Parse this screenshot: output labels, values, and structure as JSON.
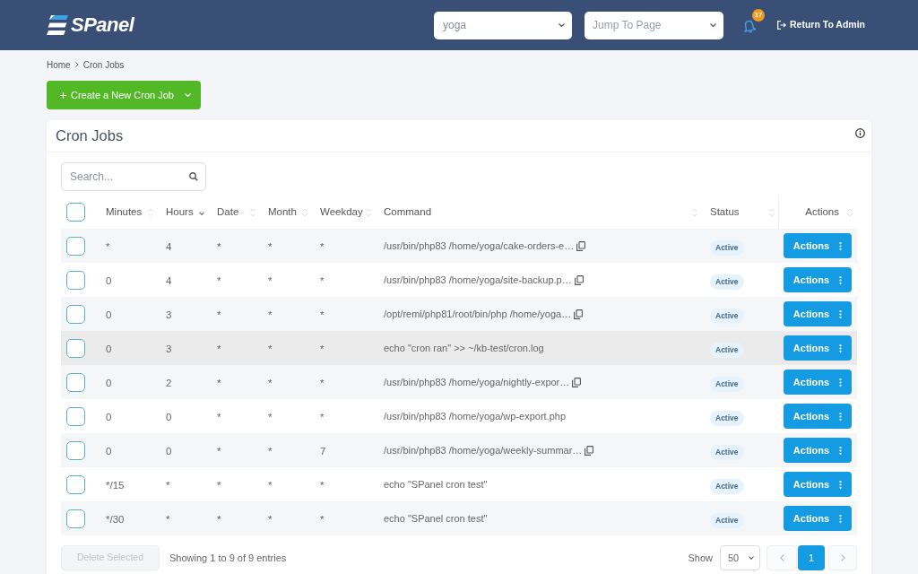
{
  "header": {
    "logo": "SPanel",
    "account_select": {
      "value": "yoga"
    },
    "page_select": {
      "placeholder": "Jump To Page"
    },
    "notifications": {
      "count": "17"
    },
    "return_link": "Return To Admin"
  },
  "breadcrumb": [
    {
      "label": "Home"
    },
    {
      "label": "Cron Jobs"
    }
  ],
  "create_button": {
    "label": "Create a New Cron Job"
  },
  "card": {
    "title": "Cron Jobs",
    "search": {
      "placeholder": "Search..."
    },
    "table": {
      "select_all": {
        "checked": false
      },
      "columns": [
        {
          "label": "Minutes",
          "sorted": false
        },
        {
          "label": "Hours",
          "sorted": true
        },
        {
          "label": "Date",
          "sorted": false
        },
        {
          "label": "Month",
          "sorted": false
        },
        {
          "label": "Weekday",
          "sorted": false
        },
        {
          "label": "Command",
          "sorted": false
        },
        {
          "label": "Status",
          "sorted": false
        },
        {
          "label": "Actions",
          "sorted": false
        }
      ],
      "rows": [
        {
          "checked": false,
          "hovered": false,
          "minutes": "*",
          "hours": "4",
          "date": "*",
          "month": "*",
          "weekday": "*",
          "command": "/usr/bin/php83 /home/yoga/cake-orders-e…",
          "copy_icon": true,
          "status": "Active",
          "action": "Actions"
        },
        {
          "checked": false,
          "hovered": false,
          "minutes": "0",
          "hours": "4",
          "date": "*",
          "month": "*",
          "weekday": "*",
          "command": "/usr/bin/php83 /home/yoga/site-backup.p…",
          "copy_icon": true,
          "status": "Active",
          "action": "Actions"
        },
        {
          "checked": false,
          "hovered": false,
          "minutes": "0",
          "hours": "3",
          "date": "*",
          "month": "*",
          "weekday": "*",
          "command": "/opt/remi/php81/root/bin/php /home/yoga…",
          "copy_icon": true,
          "status": "Active",
          "action": "Actions"
        },
        {
          "checked": false,
          "hovered": true,
          "minutes": "0",
          "hours": "3",
          "date": "*",
          "month": "*",
          "weekday": "*",
          "command": "echo \"cron ran\" >> ~/kb-test/cron.log",
          "copy_icon": false,
          "status": "Active",
          "action": "Actions"
        },
        {
          "checked": false,
          "hovered": false,
          "minutes": "0",
          "hours": "2",
          "date": "*",
          "month": "*",
          "weekday": "*",
          "command": "/usr/bin/php83 /home/yoga/nightly-expor…",
          "copy_icon": true,
          "status": "Active",
          "action": "Actions"
        },
        {
          "checked": false,
          "hovered": false,
          "minutes": "0",
          "hours": "0",
          "date": "*",
          "month": "*",
          "weekday": "*",
          "command": "/usr/bin/php83 /home/yoga/wp-export.php",
          "copy_icon": false,
          "status": "Active",
          "action": "Actions"
        },
        {
          "checked": false,
          "hovered": false,
          "minutes": "0",
          "hours": "0",
          "date": "*",
          "month": "*",
          "weekday": "7",
          "command": "/usr/bin/php83 /home/yoga/weekly-summar…",
          "copy_icon": true,
          "status": "Active",
          "action": "Actions"
        },
        {
          "checked": false,
          "hovered": false,
          "minutes": "*/15",
          "hours": "*",
          "date": "*",
          "month": "*",
          "weekday": "*",
          "command": "echo \"SPanel cron test\"",
          "copy_icon": false,
          "status": "Active",
          "action": "Actions"
        },
        {
          "checked": false,
          "hovered": false,
          "minutes": "*/30",
          "hours": "*",
          "date": "*",
          "month": "*",
          "weekday": "*",
          "command": "echo \"SPanel cron test\"",
          "copy_icon": false,
          "status": "Active",
          "action": "Actions"
        }
      ]
    },
    "footer": {
      "delete_button": {
        "label": "Delete Selected",
        "disabled": true
      },
      "summary": "Showing 1 to 9 of 9 entries",
      "show_label": "Show",
      "page_size": "50",
      "pages": [
        {
          "label": "1",
          "selected": true
        }
      ]
    }
  }
}
